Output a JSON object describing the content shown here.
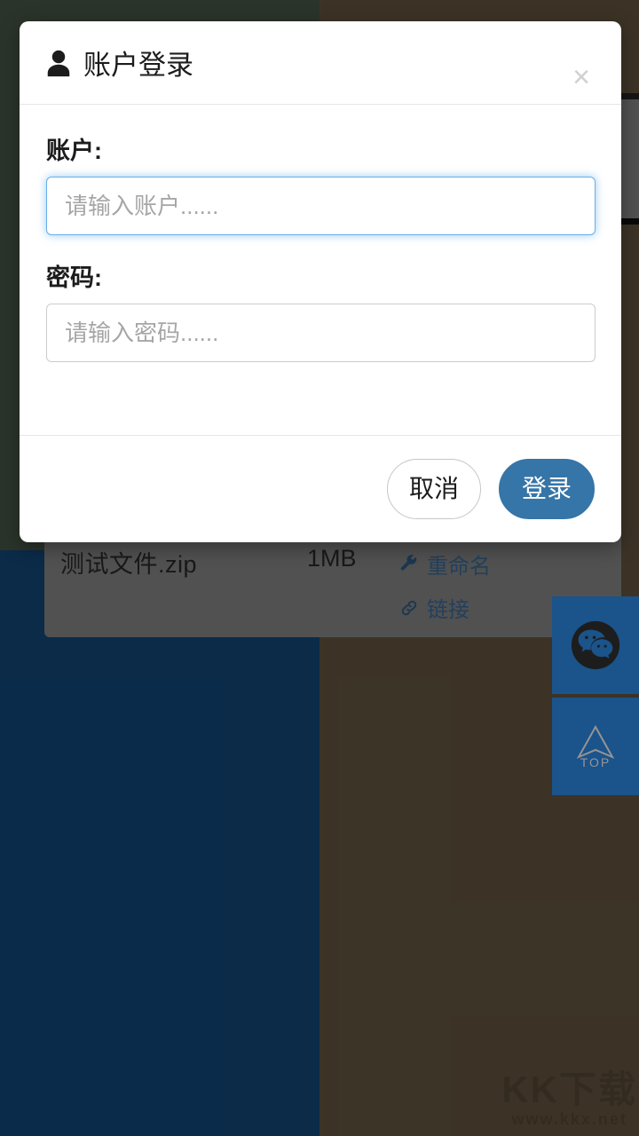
{
  "background": {
    "file_row": {
      "name": "测试文件.zip",
      "size": "1MB",
      "actions": [
        {
          "icon": "wrench-icon",
          "label": "重命名"
        },
        {
          "icon": "link-icon",
          "label": "链接"
        }
      ]
    },
    "side_buttons": [
      {
        "icon": "wechat-icon",
        "label": ""
      },
      {
        "icon": "scroll-to-top-icon",
        "label": "TOP"
      }
    ],
    "watermark": {
      "main": "KK下载",
      "sub": "www.kkx.net"
    },
    "colors": {
      "panel_green": "#4a5b4a",
      "panel_blue": "#134a7f",
      "panel_brown": "#685943",
      "side_button_blue": "#2f8fef",
      "file_card_gray": "#8c8c8c",
      "link_blue": "#3d6f9e"
    }
  },
  "modal": {
    "title": "账户登录",
    "title_icon": "person-icon",
    "close_label": "×",
    "fields": [
      {
        "label": "账户:",
        "value": "",
        "placeholder": "请输入账户......",
        "focused": true
      },
      {
        "label": "密码:",
        "value": "",
        "placeholder": "请输入密码......",
        "focused": false
      }
    ],
    "buttons": {
      "cancel": "取消",
      "submit": "登录"
    },
    "colors": {
      "primary": "#3575a8",
      "focus_border": "#66afe9",
      "border": "#cccccc",
      "divider": "#e5e5e5",
      "close": "#d0d0d0"
    }
  }
}
